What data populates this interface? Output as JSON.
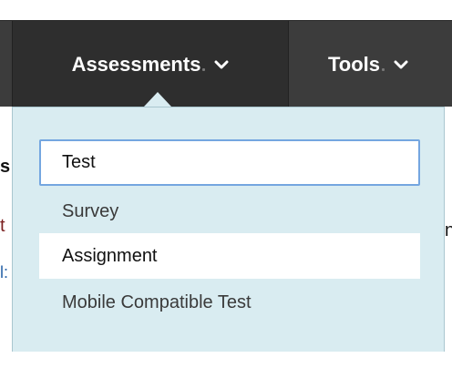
{
  "menu_bar": {
    "assessments_label": "Assessments",
    "tools_label": "Tools"
  },
  "page_fragments": {
    "left_a": "s",
    "left_b": "t",
    "left_c": "l:",
    "right_a": "n"
  },
  "dropdown": {
    "items": [
      {
        "label": "Test",
        "state": "focused"
      },
      {
        "label": "Survey",
        "state": "normal"
      },
      {
        "label": "Assignment",
        "state": "hovered"
      },
      {
        "label": "Mobile Compatible Test",
        "state": "normal"
      }
    ]
  },
  "colors": {
    "bar_bg": "#3c3c3c",
    "active_tab_bg": "#2e2e2e",
    "dropdown_bg": "#d9ecf1",
    "focus_ring": "#74a6e0"
  },
  "icons": {
    "assessments_caret": "chevron-down-icon",
    "tools_caret": "chevron-down-icon"
  }
}
